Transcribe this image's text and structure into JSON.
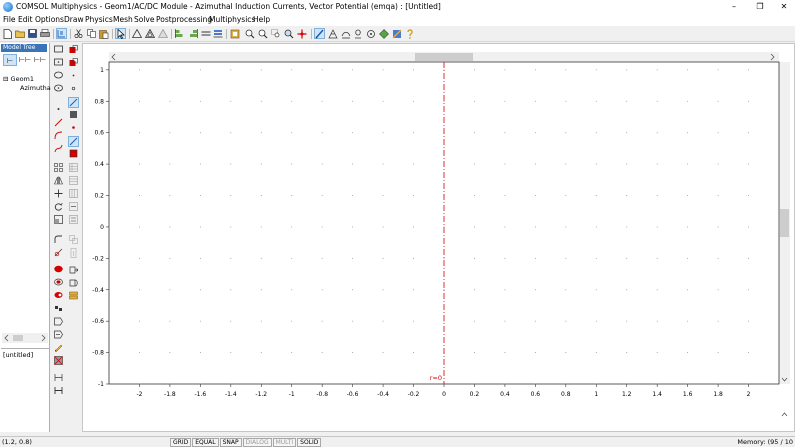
{
  "window": {
    "title": "COMSOL Multiphysics - Geom1/AC/DC Module - Azimuthal Induction Currents, Vector Potential (emqa) : [Untitled]",
    "minimize": "–",
    "restore": "❐",
    "close": "✕"
  },
  "menu": [
    "File",
    "Edit",
    "Options",
    "Draw",
    "Physics",
    "Mesh",
    "Solve",
    "Postprocessing",
    "Multiphysics",
    "Help"
  ],
  "model_tree": {
    "label": "Model Tree",
    "buttons": [
      "⊢",
      "⊢⊢",
      "⊢⊢"
    ],
    "items": [
      {
        "label": "Geom1",
        "expander": "⊟"
      },
      {
        "label": "Azimutha"
      }
    ],
    "properties_label": "[untitled]"
  },
  "canvas": {
    "symmetry_label": "r=0",
    "x_ticks": [
      "-2",
      "-1.8",
      "-1.6",
      "-1.4",
      "-1.2",
      "-1",
      "-0.8",
      "-0.6",
      "-0.4",
      "-0.2",
      "0",
      "0.2",
      "0.4",
      "0.6",
      "0.8",
      "1",
      "1.2",
      "1.4",
      "1.6",
      "1.8",
      "2"
    ],
    "y_ticks": [
      "1",
      "0.8",
      "0.6",
      "0.4",
      "0.2",
      "0",
      "-0.2",
      "-0.4",
      "-0.6",
      "-0.8",
      "-1"
    ],
    "colors": {
      "axis_line": "#d40000",
      "grid_dot": "#808080",
      "scroll_thumb": "#cdcdcd"
    }
  },
  "status": {
    "coords": "(1.2, 0.8)",
    "modes": [
      {
        "label": "GRID",
        "enabled": true
      },
      {
        "label": "EQUAL",
        "enabled": true
      },
      {
        "label": "SNAP",
        "enabled": true
      },
      {
        "label": "DIALOG",
        "enabled": false
      },
      {
        "label": "MULTI",
        "enabled": false
      },
      {
        "label": "SOLID",
        "enabled": true
      }
    ],
    "memory": "Memory: (95 / 10"
  }
}
